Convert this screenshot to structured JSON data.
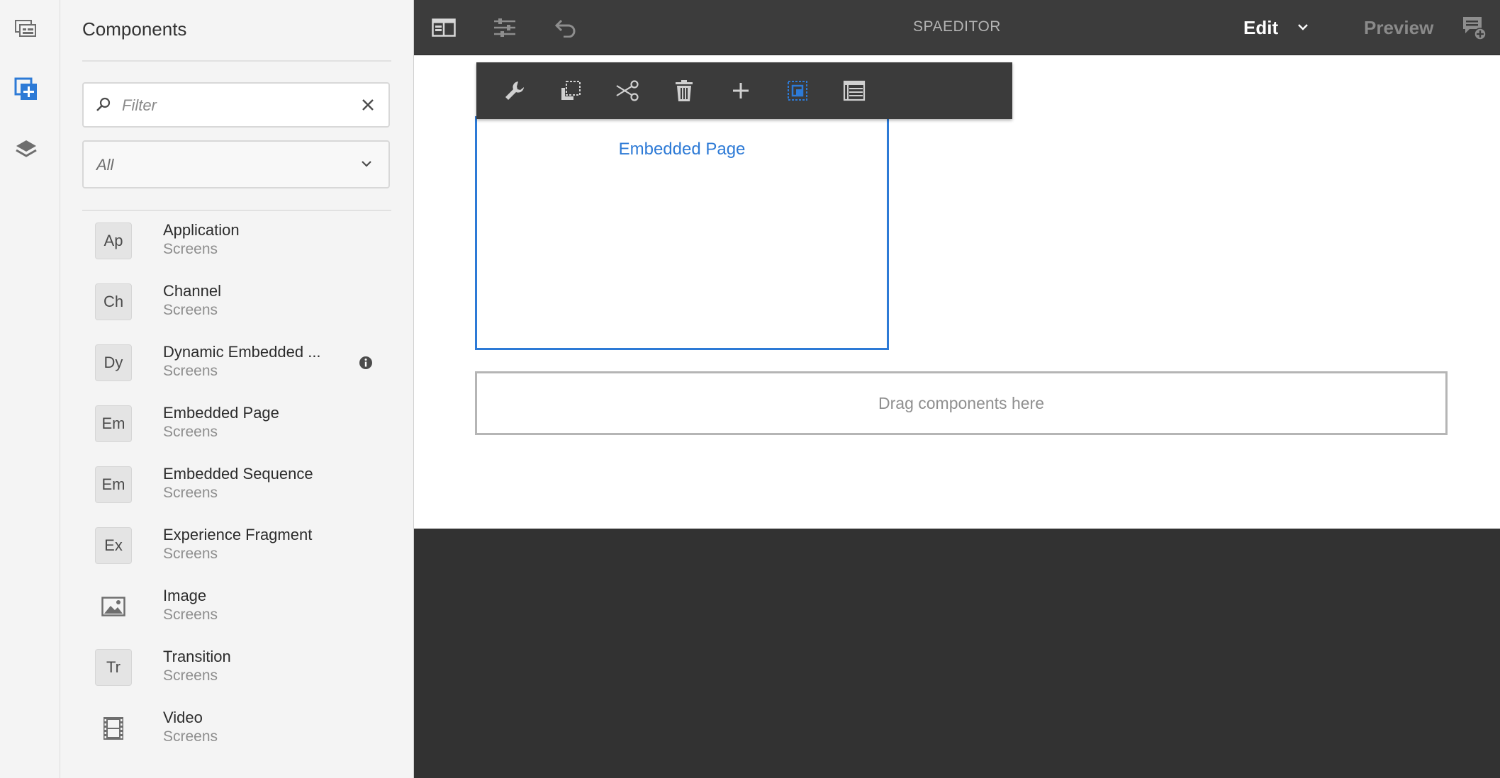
{
  "app": {
    "title": "SPAEDITOR"
  },
  "header": {
    "mode_label": "Edit",
    "preview_label": "Preview",
    "icons": [
      "side-panel-icon",
      "page-properties-icon",
      "undo-icon",
      "chevron-down-icon",
      "annotate-icon"
    ]
  },
  "rail": {
    "icons": [
      "assets-icon",
      "components-icon",
      "content-tree-icon"
    ],
    "accent": "#2d7ad6"
  },
  "components_panel": {
    "title": "Components",
    "filter": {
      "placeholder": "Filter",
      "value": ""
    },
    "group_select": {
      "value": "All"
    },
    "items": [
      {
        "badge": "Ap",
        "icon": "",
        "name": "Application",
        "group": "Screens",
        "info": false
      },
      {
        "badge": "Ch",
        "icon": "",
        "name": "Channel",
        "group": "Screens",
        "info": false
      },
      {
        "badge": "Dy",
        "icon": "",
        "name": "Dynamic Embedded ...",
        "group": "Screens",
        "info": true
      },
      {
        "badge": "Em",
        "icon": "",
        "name": "Embedded Page",
        "group": "Screens",
        "info": false
      },
      {
        "badge": "Em",
        "icon": "",
        "name": "Embedded Sequence",
        "group": "Screens",
        "info": false
      },
      {
        "badge": "Ex",
        "icon": "",
        "name": "Experience Fragment",
        "group": "Screens",
        "info": false
      },
      {
        "badge": "",
        "icon": "image-icon",
        "name": "Image",
        "group": "Screens",
        "info": false
      },
      {
        "badge": "Tr",
        "icon": "",
        "name": "Transition",
        "group": "Screens",
        "info": false
      },
      {
        "badge": "",
        "icon": "video-icon",
        "name": "Video",
        "group": "Screens",
        "info": false
      }
    ]
  },
  "canvas": {
    "selected_component_label": "Embedded Page",
    "drop_zone_text": "Drag components here",
    "edit_toolbar_icons": [
      "configure-icon",
      "copy-icon",
      "cut-icon",
      "delete-icon",
      "insert-icon",
      "parent-select-icon",
      "layout-icon"
    ]
  },
  "colors": {
    "accent": "#2d7ad6",
    "topbar": "#3c3c3c",
    "panel": "#f4f4f4"
  }
}
